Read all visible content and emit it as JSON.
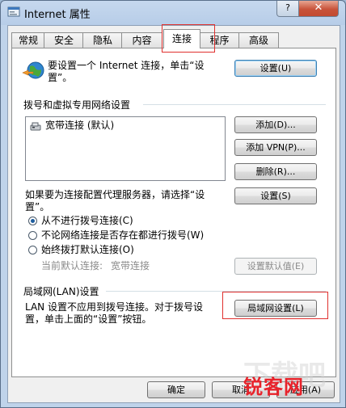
{
  "window": {
    "title": "Internet 属性",
    "help_label": "?",
    "close_label": "✕"
  },
  "tabs": [
    "常规",
    "安全",
    "隐私",
    "内容",
    "连接",
    "程序",
    "高级"
  ],
  "active_tab": "连接",
  "setup": {
    "text_line1": "要设置一个 Internet 连接，单击“设",
    "text_line2": "置”。",
    "button": "设置(U)"
  },
  "dialup": {
    "section_label": "拨号和虚拟专用网络设置",
    "items": [
      "宽带连接 (默认)"
    ],
    "add_button": "添加(D)...",
    "add_vpn_button": "添加 VPN(P)...",
    "remove_button": "删除(R)...",
    "proxy_text_line1": "如果要为连接配置代理服务器，请选择“设",
    "proxy_text_line2": "置”。",
    "settings_button": "设置(S)",
    "radio_options": [
      "从不进行拨号连接(C)",
      "不论网络连接是否存在都进行拨号(W)",
      "始终拨打默认连接(O)"
    ],
    "selected_radio": 0,
    "current_default_label": "当前默认连接:",
    "current_default_value": "宽带连接",
    "set_default_button": "设置默认值(E)"
  },
  "lan": {
    "section_label": "局域网(LAN)设置",
    "text_line1": "LAN 设置不应用到拨号连接。对于拨号设",
    "text_line2": "置，单击上面的“设置”按钮。",
    "button": "局域网设置(L)"
  },
  "footer": {
    "ok": "确定",
    "cancel": "取消",
    "apply": "应用(A)"
  },
  "watermark": {
    "text": "锐客网",
    "faint": "下载吧"
  },
  "colors": {
    "highlight_box": "#e0302e",
    "watermark_red": "#e8232b"
  }
}
